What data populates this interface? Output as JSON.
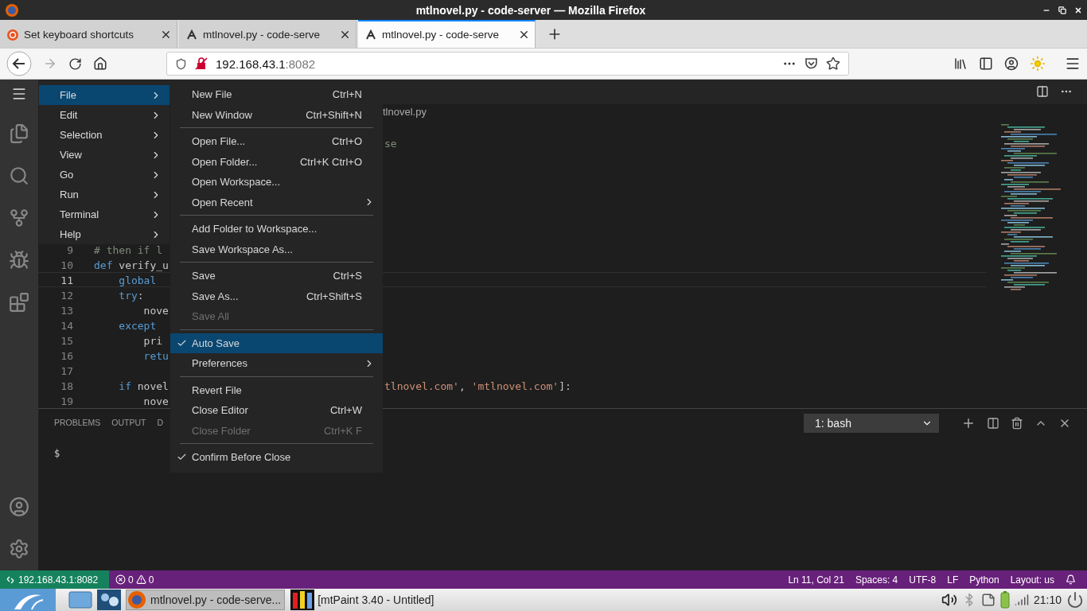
{
  "window": {
    "title": "mtlnovel.py - code-server — Mozilla Firefox"
  },
  "browser_tabs": [
    {
      "label": "Set keyboard shortcuts",
      "selected": false
    },
    {
      "label": "mtlnovel.py - code-serve",
      "selected": false
    },
    {
      "label": "mtlnovel.py - code-serve",
      "selected": true
    }
  ],
  "address_bar": {
    "host": "192.168.43.1",
    "port": ":8082"
  },
  "editor": {
    "breadcrumb": "tlnovel.py",
    "top_fragment": "se",
    "lines": [
      {
        "number": "9",
        "current": false,
        "left": [
          {
            "text": "# then if l",
            "kind": "comment"
          }
        ]
      },
      {
        "number": "10",
        "current": false,
        "left": [
          {
            "text": "def",
            "kind": "keyword"
          },
          {
            "text": " verify_u",
            "kind": "plain"
          }
        ]
      },
      {
        "number": "11",
        "current": true,
        "left": [
          {
            "text": "    global",
            "kind": "keyword"
          }
        ]
      },
      {
        "number": "12",
        "current": false,
        "left": [
          {
            "text": "    try",
            "kind": "keyword"
          },
          {
            "text": ":",
            "kind": "plain"
          }
        ]
      },
      {
        "number": "13",
        "current": false,
        "left": [
          {
            "text": "        nove",
            "kind": "plain"
          }
        ]
      },
      {
        "number": "14",
        "current": false,
        "left": [
          {
            "text": "    except",
            "kind": "keyword"
          }
        ]
      },
      {
        "number": "15",
        "current": false,
        "left": [
          {
            "text": "        pri",
            "kind": "plain"
          }
        ]
      },
      {
        "number": "16",
        "current": false,
        "left": [
          {
            "text": "        retu",
            "kind": "keyword"
          }
        ]
      },
      {
        "number": "17",
        "current": false
      },
      {
        "number": "18",
        "current": false,
        "left": [
          {
            "text": "    if",
            "kind": "keyword"
          },
          {
            "text": " novel",
            "kind": "plain"
          }
        ],
        "right": [
          {
            "text": "tlnovel.com'",
            "kind": "string"
          },
          {
            "text": ", ",
            "kind": "plain"
          },
          {
            "text": "'mtlnovel.com'",
            "kind": "string"
          },
          {
            "text": "]:",
            "kind": "plain"
          }
        ]
      },
      {
        "number": "19",
        "current": false,
        "left": [
          {
            "text": "        nove",
            "kind": "plain"
          }
        ]
      }
    ]
  },
  "menu_bar": {
    "items": [
      {
        "label": "File",
        "selected": true
      },
      {
        "label": "Edit",
        "selected": false
      },
      {
        "label": "Selection",
        "selected": false
      },
      {
        "label": "View",
        "selected": false
      },
      {
        "label": "Go",
        "selected": false
      },
      {
        "label": "Run",
        "selected": false
      },
      {
        "label": "Terminal",
        "selected": false
      },
      {
        "label": "Help",
        "selected": false
      }
    ]
  },
  "file_menu": {
    "items": [
      {
        "kind": "item",
        "label": "New File",
        "shortcut": "Ctrl+N",
        "submenu": false,
        "checked": false,
        "disabled": false,
        "selected": false
      },
      {
        "kind": "item",
        "label": "New Window",
        "shortcut": "Ctrl+Shift+N",
        "submenu": false,
        "checked": false,
        "disabled": false,
        "selected": false
      },
      {
        "kind": "separator"
      },
      {
        "kind": "item",
        "label": "Open File...",
        "shortcut": "Ctrl+O",
        "submenu": false,
        "checked": false,
        "disabled": false,
        "selected": false
      },
      {
        "kind": "item",
        "label": "Open Folder...",
        "shortcut": "Ctrl+K Ctrl+O",
        "submenu": false,
        "checked": false,
        "disabled": false,
        "selected": false
      },
      {
        "kind": "item",
        "label": "Open Workspace...",
        "submenu": false,
        "checked": false,
        "disabled": false,
        "selected": false
      },
      {
        "kind": "item",
        "label": "Open Recent",
        "submenu": true,
        "checked": false,
        "disabled": false,
        "selected": false
      },
      {
        "kind": "separator"
      },
      {
        "kind": "item",
        "label": "Add Folder to Workspace...",
        "submenu": false,
        "checked": false,
        "disabled": false,
        "selected": false
      },
      {
        "kind": "item",
        "label": "Save Workspace As...",
        "submenu": false,
        "checked": false,
        "disabled": false,
        "selected": false
      },
      {
        "kind": "separator"
      },
      {
        "kind": "item",
        "label": "Save",
        "shortcut": "Ctrl+S",
        "submenu": false,
        "checked": false,
        "disabled": false,
        "selected": false
      },
      {
        "kind": "item",
        "label": "Save As...",
        "shortcut": "Ctrl+Shift+S",
        "submenu": false,
        "checked": false,
        "disabled": false,
        "selected": false
      },
      {
        "kind": "item",
        "label": "Save All",
        "submenu": false,
        "checked": false,
        "disabled": true,
        "selected": false
      },
      {
        "kind": "separator"
      },
      {
        "kind": "item",
        "label": "Auto Save",
        "submenu": false,
        "checked": true,
        "disabled": false,
        "selected": true
      },
      {
        "kind": "item",
        "label": "Preferences",
        "submenu": true,
        "checked": false,
        "disabled": false,
        "selected": false
      },
      {
        "kind": "separator"
      },
      {
        "kind": "item",
        "label": "Revert File",
        "submenu": false,
        "checked": false,
        "disabled": false,
        "selected": false
      },
      {
        "kind": "item",
        "label": "Close Editor",
        "shortcut": "Ctrl+W",
        "submenu": false,
        "checked": false,
        "disabled": false,
        "selected": false
      },
      {
        "kind": "item",
        "label": "Close Folder",
        "shortcut": "Ctrl+K F",
        "submenu": false,
        "checked": false,
        "disabled": true,
        "selected": false
      },
      {
        "kind": "separator"
      },
      {
        "kind": "item",
        "label": "Confirm Before Close",
        "submenu": false,
        "checked": true,
        "disabled": false,
        "selected": false
      }
    ]
  },
  "panel": {
    "tabs": [
      {
        "label": "PROBLEMS",
        "selected": false
      },
      {
        "label": "OUTPUT",
        "selected": false
      },
      {
        "label": "D",
        "selected": false
      }
    ],
    "terminal_select": "1: bash",
    "prompt": "$"
  },
  "status_bar": {
    "remote": "192.168.43.1:8082",
    "errors": "0",
    "warnings": "0",
    "items": [
      "Ln 11, Col 21",
      "Spaces: 4",
      "UTF-8",
      "LF",
      "Python",
      "Layout: us"
    ]
  },
  "taskbar": {
    "tasks": [
      {
        "label": "mtlnovel.py - code-serve...",
        "selected": true
      },
      {
        "label": "[mtPaint 3.40 - Untitled]",
        "selected": false
      }
    ],
    "clock": "21:10"
  }
}
